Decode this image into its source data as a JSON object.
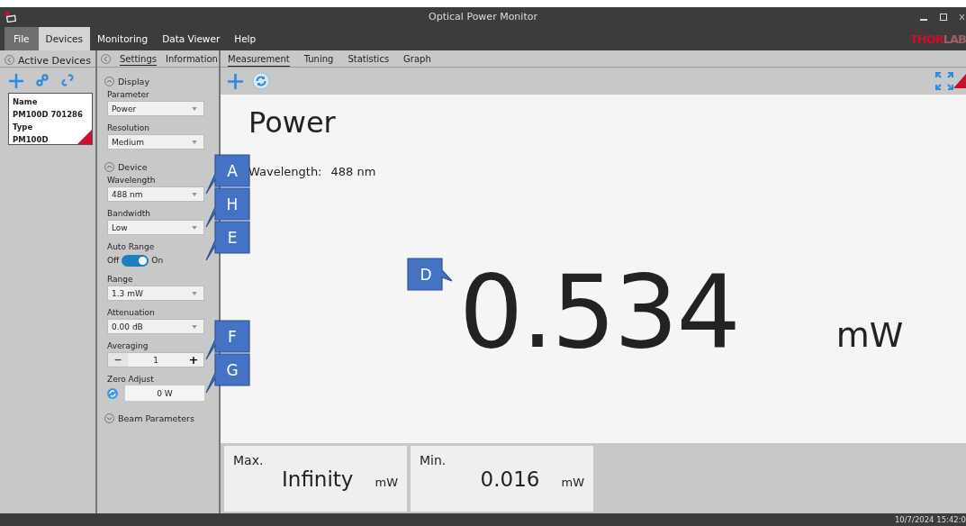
{
  "window": {
    "title": "Optical Power Monitor"
  },
  "logo": {
    "strong": "THOR",
    "light": "LAB"
  },
  "menu": [
    {
      "label": "File",
      "kind": "file",
      "selected": false
    },
    {
      "label": "Devices",
      "kind": "menu",
      "selected": true
    },
    {
      "label": "Monitoring",
      "kind": "menu",
      "selected": false
    },
    {
      "label": "Data Viewer",
      "kind": "menu",
      "selected": false
    },
    {
      "label": "Help",
      "kind": "menu",
      "selected": false
    }
  ],
  "devices_panel": {
    "title": "Active Devices",
    "device": {
      "name_label": "Name",
      "name": "PM100D 701286",
      "type_label": "Type",
      "type": "PM100D"
    }
  },
  "settings_panel": {
    "tabs": [
      {
        "label": "Settings",
        "selected": true
      },
      {
        "label": "Information",
        "selected": false
      }
    ],
    "sections": [
      {
        "title": "Display",
        "expanded": true,
        "fields": [
          {
            "kind": "select",
            "label": "Parameter",
            "value": "Power"
          },
          {
            "kind": "select",
            "label": "Resolution",
            "value": "Medium"
          }
        ]
      },
      {
        "title": "Device",
        "expanded": true,
        "fields": [
          {
            "kind": "select",
            "label": "Wavelength",
            "value": "488 nm",
            "callout": "A"
          },
          {
            "kind": "select",
            "label": "Bandwidth",
            "value": "Low",
            "callout": "H"
          },
          {
            "kind": "toggle",
            "label": "Auto Range",
            "off_label": "Off",
            "on_label": "On",
            "on": true,
            "callout": "E"
          },
          {
            "kind": "select",
            "label": "Range",
            "value": "1.3 mW"
          },
          {
            "kind": "select",
            "label": "Attenuation",
            "value": "0.00 dB"
          },
          {
            "kind": "stepper",
            "label": "Averaging",
            "minus": "−",
            "value": "1",
            "plus": "+",
            "callout": "F"
          },
          {
            "kind": "zero",
            "label": "Zero Adjust",
            "value": "0 W",
            "callout": "G"
          }
        ]
      },
      {
        "title": "Beam Parameters",
        "expanded": false
      }
    ]
  },
  "main": {
    "tabs": [
      {
        "label": "Measurement",
        "selected": true
      },
      {
        "label": "Tuning",
        "selected": false
      },
      {
        "label": "Statistics",
        "selected": false
      },
      {
        "label": "Graph",
        "selected": false
      }
    ],
    "measurement": {
      "title": "Power",
      "wavelength_label": "Wavelength:",
      "wavelength": "488 nm",
      "value": "0.534",
      "unit": "mW",
      "callout": "D"
    },
    "stats": [
      {
        "label": "Max.",
        "value": "Infinity",
        "unit": "mW"
      },
      {
        "label": "Min.",
        "value": "0.016",
        "unit": "mW"
      }
    ]
  },
  "status_bar": {
    "timestamp": "10/7/2024 15:42:0"
  }
}
